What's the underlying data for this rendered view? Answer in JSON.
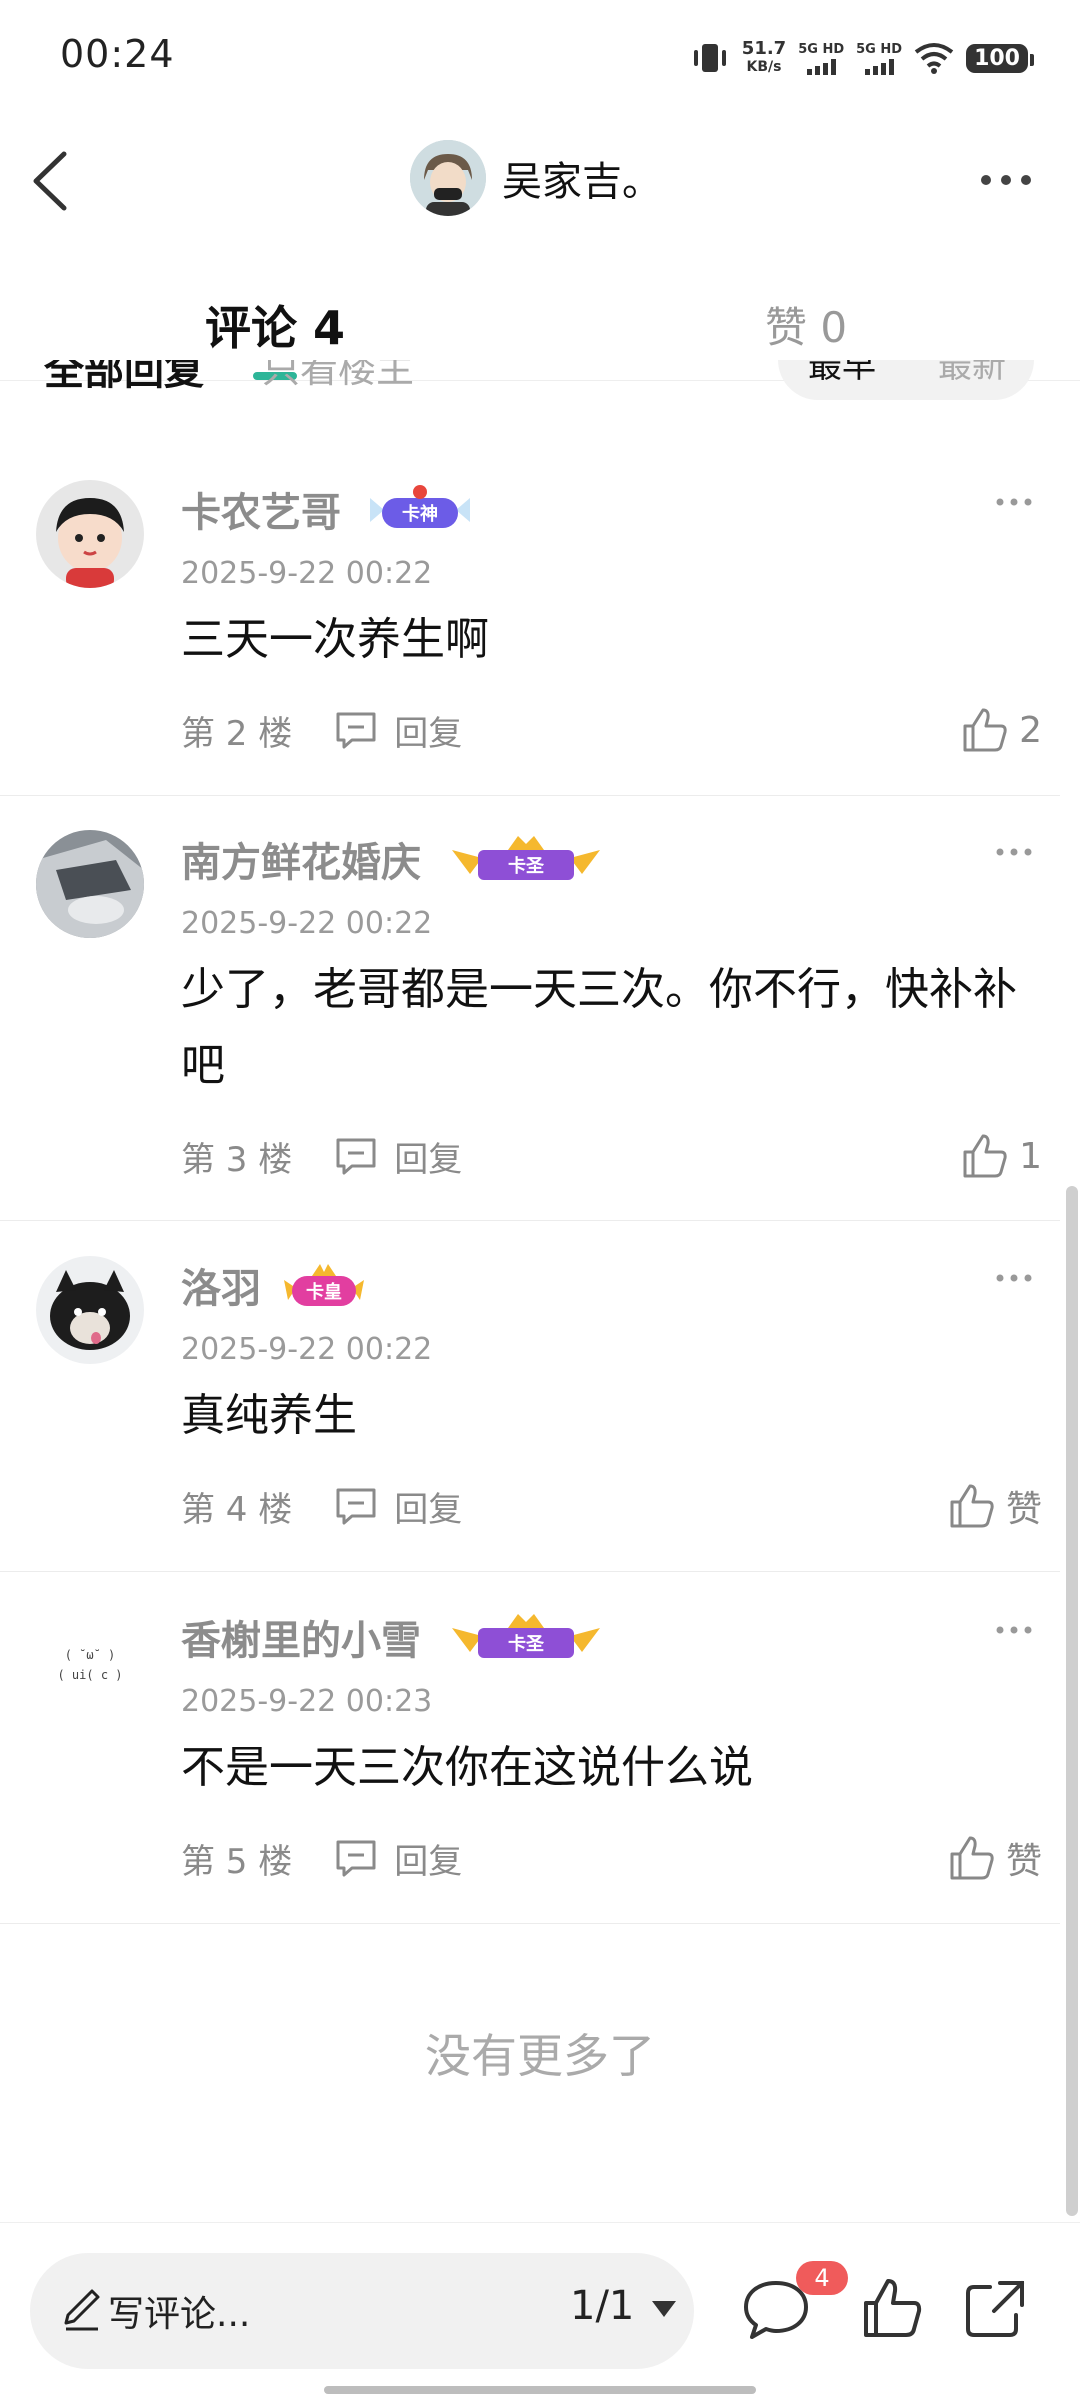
{
  "status_bar": {
    "time": "00:24",
    "net_speed_value": "51.7",
    "net_speed_unit": "KB/s",
    "sim1": "5G HD",
    "sim2": "5G HD",
    "battery": "100"
  },
  "header": {
    "title": "吴家吉。"
  },
  "tabs": {
    "comments_label": "评论 4",
    "likes_label": "赞 0"
  },
  "filter": {
    "all_replies": "全部回复",
    "only_op": "只看楼主",
    "sort_hot": "最早",
    "sort_new": "最新"
  },
  "comments": [
    {
      "username": "卡农艺哥",
      "badge": "卡神",
      "time": "2025-9-22 00:22",
      "content": "三天一次养生啊",
      "floor": "第 2 楼",
      "reply_label": "回复",
      "likes": "2"
    },
    {
      "username": "南方鲜花婚庆",
      "badge": "卡圣",
      "time": "2025-9-22 00:22",
      "content": "少了，老哥都是一天三次。你不行，快补补吧",
      "floor": "第 3 楼",
      "reply_label": "回复",
      "likes": "1"
    },
    {
      "username": "洛羽",
      "badge": "卡皇",
      "time": "2025-9-22 00:22",
      "content": "真纯养生",
      "floor": "第 4 楼",
      "reply_label": "回复",
      "likes": "赞"
    },
    {
      "username": "香榭里的小雪",
      "badge": "卡圣",
      "time": "2025-9-22 00:23",
      "content": "不是一天三次你在这说什么说",
      "floor": "第 5 楼",
      "reply_label": "回复",
      "likes": "赞",
      "avatar_text_line1": "( ˘ω˘ )",
      "avatar_text_line2": "( ui( c )"
    }
  ],
  "end_text": "没有更多了",
  "bottom_bar": {
    "write_placeholder": "写评论...",
    "page_indicator": "1/1",
    "comment_count_badge": "4"
  },
  "colors": {
    "accent": "#2db598",
    "badge_red": "#f05b5b",
    "muted_text": "#8c8c8c"
  }
}
